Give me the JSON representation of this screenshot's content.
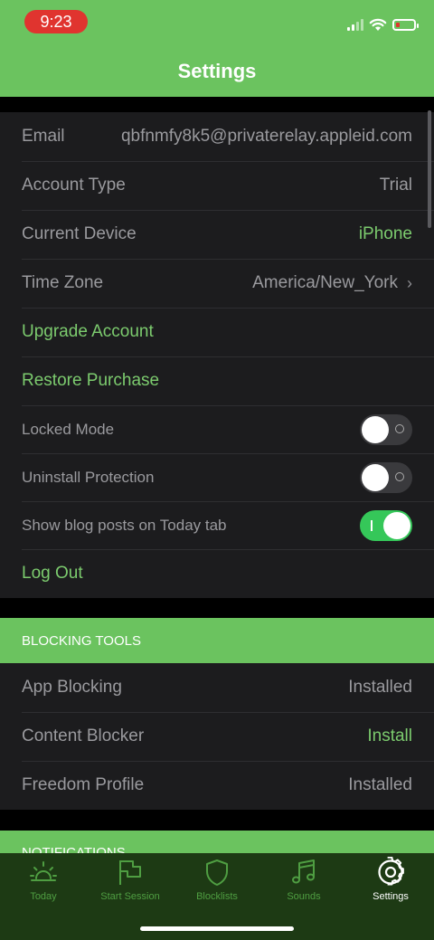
{
  "status": {
    "time": "9:23"
  },
  "header": {
    "title": "Settings"
  },
  "account": {
    "email_label": "Email",
    "email_value": "qbfnmfy8k5@privaterelay.appleid.com",
    "type_label": "Account Type",
    "type_value": "Trial",
    "device_label": "Current Device",
    "device_value": "iPhone",
    "timezone_label": "Time Zone",
    "timezone_value": "America/New_York",
    "upgrade_label": "Upgrade Account",
    "restore_label": "Restore Purchase",
    "locked_label": "Locked Mode",
    "uninstall_label": "Uninstall Protection",
    "blog_label": "Show blog posts on Today tab",
    "logout_label": "Log Out",
    "locked_on": false,
    "uninstall_on": false,
    "blog_on": true
  },
  "blocking": {
    "header": "BLOCKING TOOLS",
    "app_label": "App Blocking",
    "app_value": "Installed",
    "content_label": "Content Blocker",
    "content_value": "Install",
    "profile_label": "Freedom Profile",
    "profile_value": "Installed"
  },
  "notifications": {
    "header": "NOTIFICATIONS"
  },
  "tabs": [
    {
      "label": "Today",
      "icon": "sunrise-icon"
    },
    {
      "label": "Start Session",
      "icon": "flag-icon"
    },
    {
      "label": "Blocklists",
      "icon": "shield-icon"
    },
    {
      "label": "Sounds",
      "icon": "music-note-icon"
    },
    {
      "label": "Settings",
      "icon": "gear-icon"
    }
  ],
  "colors": {
    "accent": "#6bc35f",
    "tabbar": "#1d3a14",
    "row_bg": "#1c1c1e"
  }
}
